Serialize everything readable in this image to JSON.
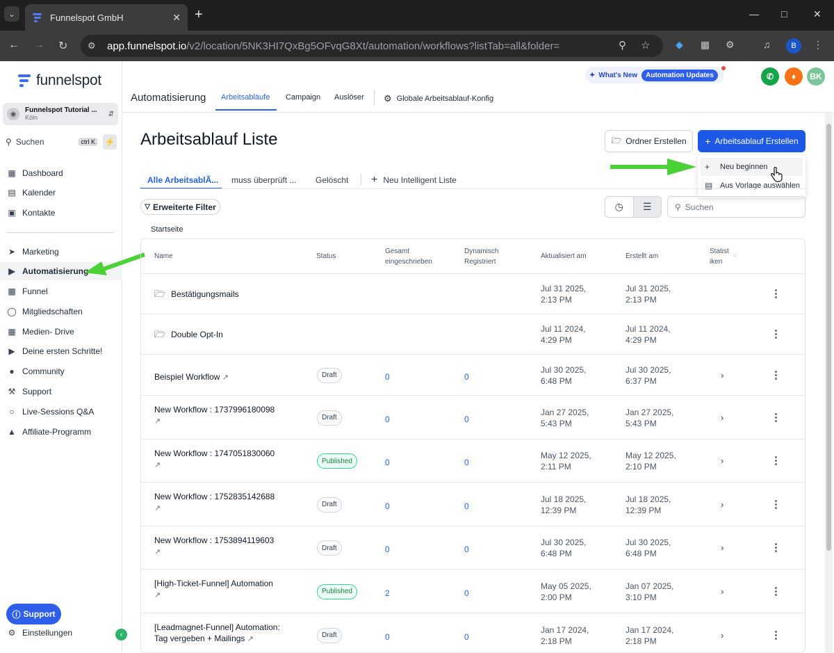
{
  "browser": {
    "tab_title": "Funnelspot GmbH",
    "url_host": "app.funnelspot.io",
    "url_path": "/v2/location/5NK3HI7QxBg5OFvqG8Xt/automation/workflows?listTab=all&folder=",
    "profile_initial": "B"
  },
  "sidebar": {
    "logo_text": "funnelspot",
    "location_name": "Funnelspot Tutorial ...",
    "location_city": "Köln",
    "search_label": "Suchen",
    "search_shortcut": "ctrl K",
    "items": [
      {
        "label": "Dashboard",
        "icon": "grid-icon"
      },
      {
        "label": "Kalender",
        "icon": "calendar-icon"
      },
      {
        "label": "Kontakte",
        "icon": "contacts-icon"
      },
      {
        "label": "Marketing",
        "icon": "send-icon"
      },
      {
        "label": "Automatisierung",
        "icon": "automation-icon"
      },
      {
        "label": "Funnel",
        "icon": "funnel-icon"
      },
      {
        "label": "Mitgliedschaften",
        "icon": "badge-icon"
      },
      {
        "label": "Medien- Drive",
        "icon": "image-icon"
      },
      {
        "label": "Deine ersten Schritte!",
        "icon": "play-icon"
      },
      {
        "label": "Community",
        "icon": "people-icon"
      },
      {
        "label": "Support",
        "icon": "wrench-icon"
      },
      {
        "label": "Live-Sessions Q&A",
        "icon": "chat-icon"
      },
      {
        "label": "Affiliate-Programm",
        "icon": "affiliate-icon"
      }
    ],
    "support_button": "Support",
    "settings_label": "Einstellungen"
  },
  "header": {
    "whats_new": "What's New",
    "automation_updates": "Automation Updates",
    "avatar_initials": "BK",
    "app_title": "Automatisierung",
    "tabs": [
      "Arbeitsabläufe",
      "Campaign",
      "Auslöser",
      "Globale Arbeitsablauf-Konfig"
    ]
  },
  "main": {
    "title": "Arbeitsablauf Liste",
    "btn_folder": "Ordner Erstellen",
    "btn_create": "Arbeitsablauf Erstellen",
    "dropdown": [
      "Neu beginnen",
      "Aus Vorlage auswählen"
    ],
    "list_tabs": [
      "Alle ArbeitsablÃ...",
      "muss überprüft ...",
      "Gelöscht",
      "Neu Intelligent Liste"
    ],
    "filter_label": "Erweiterte Filter",
    "search_placeholder": "Suchen",
    "breadcrumb": "Startseite"
  },
  "table": {
    "headers": {
      "name": "Name",
      "status": "Status",
      "enrolled_1": "Gesamt",
      "enrolled_2": "eingeschrieben",
      "dynamic_1": "Dynamisch",
      "dynamic_2": "Registriert",
      "updated": "Aktualisiert am",
      "created": "Erstellt am",
      "stats_1": "Statist",
      "stats_2": "iken"
    },
    "rows": [
      {
        "name1": "Bestätigungsmails",
        "name2": "",
        "folder": true,
        "status": "",
        "enrolled": "",
        "dynamic": "",
        "upd1": "Jul 31 2025,",
        "upd2": "2:13 PM",
        "cr1": "Jul 31 2025,",
        "cr2": "2:13 PM"
      },
      {
        "name1": "Double Opt-In",
        "name2": "",
        "folder": true,
        "status": "",
        "enrolled": "",
        "dynamic": "",
        "upd1": "Jul 11 2024,",
        "upd2": "4:29 PM",
        "cr1": "Jul 11 2024,",
        "cr2": "4:29 PM"
      },
      {
        "name1": "Beispiel Workflow",
        "name2": "",
        "folder": false,
        "status": "Draft",
        "enrolled": "0",
        "dynamic": "0",
        "upd1": "Jul 30 2025,",
        "upd2": "6:48 PM",
        "cr1": "Jul 30 2025,",
        "cr2": "6:37 PM"
      },
      {
        "name1": "New Workflow : 1737996180098",
        "name2": "",
        "folder": false,
        "status": "Draft",
        "enrolled": "0",
        "dynamic": "0",
        "upd1": "Jan 27 2025,",
        "upd2": "5:43 PM",
        "cr1": "Jan 27 2025,",
        "cr2": "5:43 PM"
      },
      {
        "name1": "New Workflow : 1747051830060",
        "name2": "",
        "folder": false,
        "status": "Published",
        "enrolled": "0",
        "dynamic": "0",
        "upd1": "May 12 2025,",
        "upd2": "2:11 PM",
        "cr1": "May 12 2025,",
        "cr2": "2:10 PM"
      },
      {
        "name1": "New Workflow : 1752835142688",
        "name2": "",
        "folder": false,
        "status": "Draft",
        "enrolled": "0",
        "dynamic": "0",
        "upd1": "Jul 18 2025,",
        "upd2": "12:39 PM",
        "cr1": "Jul 18 2025,",
        "cr2": "12:39 PM"
      },
      {
        "name1": "New Workflow : 1753894119603",
        "name2": "",
        "folder": false,
        "status": "Draft",
        "enrolled": "0",
        "dynamic": "0",
        "upd1": "Jul 30 2025,",
        "upd2": "6:48 PM",
        "cr1": "Jul 30 2025,",
        "cr2": "6:48 PM"
      },
      {
        "name1": "[High-Ticket-Funnel] Automation",
        "name2": "",
        "folder": false,
        "status": "Published",
        "enrolled": "2",
        "dynamic": "0",
        "upd1": "May 05 2025,",
        "upd2": "2:00 PM",
        "cr1": "Jan 07 2025,",
        "cr2": "3:10 PM"
      },
      {
        "name1": "[Leadmagnet-Funnel] Automation:",
        "name2": "Tag vergeben + Mailings",
        "folder": false,
        "status": "Draft",
        "enrolled": "0",
        "dynamic": "0",
        "upd1": "Jan 17 2024,",
        "upd2": "2:18 PM",
        "cr1": "Jan 17 2024,",
        "cr2": "2:18 PM"
      }
    ]
  },
  "colors": {
    "accent": "#1d58e6",
    "annotation_arrow": "#4cd137",
    "published": "#15803d"
  }
}
